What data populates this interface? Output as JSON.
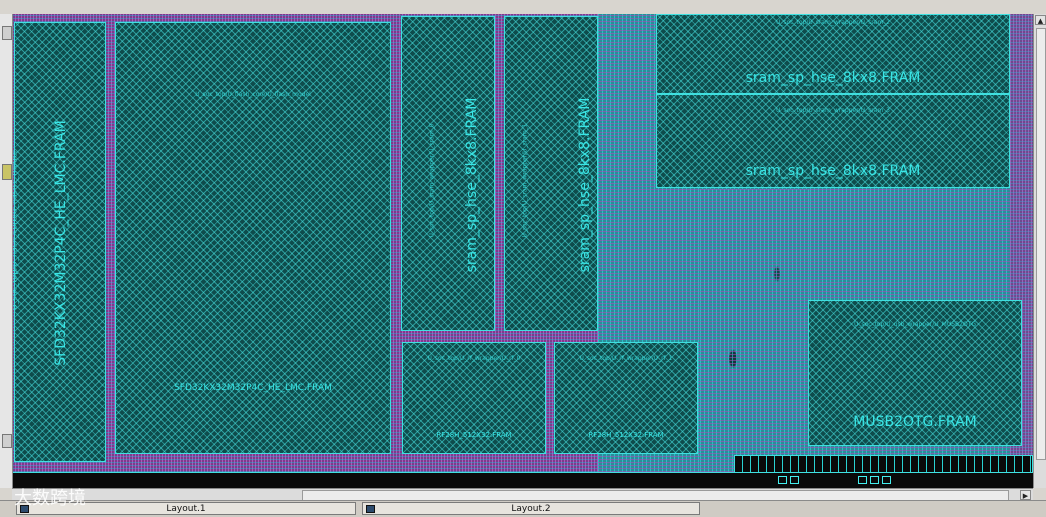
{
  "macros": {
    "sfd_vertical": "SFD32KX32M32P4C_HE_LMC.FRAM",
    "sfd_horizontal": "SFD32KX32M32P4C_HE_LMC.FRAM",
    "sfd_inst": "U_soc_top/U_flash_core/U_flash_model",
    "left_hier_path": "U_soc_top/U_flash_core/U_flash1_model",
    "sram_v1": "sram_sp_hse_8kx8.FRAM",
    "sram_v2": "sram_sp_hse_8kx8.FRAM",
    "sram_v_inst1": "U_soc_top/U_sram_wrapper/U_sram_0",
    "sram_v_inst2": "U_soc_top/U_sram_wrapper/U_sram_1",
    "sram_h1": "sram_sp_hse_8kx8.FRAM",
    "sram_h2": "sram_sp_hse_8kx8.FRAM",
    "sram_h_inst1": "U_soc_top/U_sram_wrapper/U_sram_2",
    "sram_h_inst2": "U_soc_top/U_sram_wrapper/U_sram_3",
    "rf_1": "RF28H_512X32.FRAM",
    "rf_2": "RF28H_512X32.FRAM",
    "rf_inst1": "U_soc_top/U_rf_wrapper/U_rf_0",
    "rf_inst2": "U_soc_top/U_rf_wrapper/U_rf_1",
    "musb": "MUSB2OTG.FRAM",
    "musb_inst": "U_soc_top/U_usb_wrapper/U_MUSB2OTG"
  },
  "tabs": [
    {
      "label": "Layout.1"
    },
    {
      "label": "Layout.2"
    }
  ],
  "watermark": "大数跨境",
  "colors": {
    "macro_border": "#3fe0e0",
    "macro_fill": "#0e4c4c",
    "label": "#39e6e6",
    "stdcell_magenta": "#7b3d8b"
  }
}
